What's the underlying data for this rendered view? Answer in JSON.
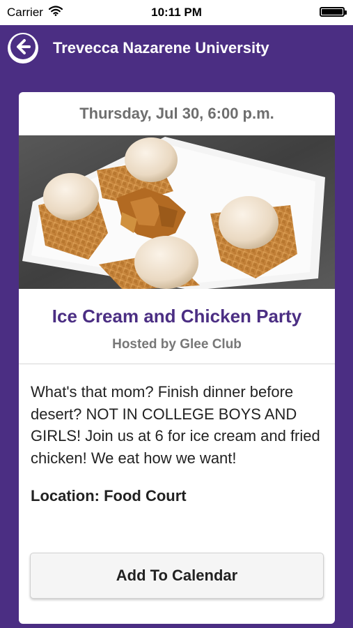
{
  "status_bar": {
    "carrier": "Carrier",
    "time": "10:11 PM"
  },
  "nav": {
    "title": "Trevecca Nazarene University",
    "back_icon": "arrow-left-circle-icon"
  },
  "event": {
    "date": "Thursday, Jul 30, 6:00 p.m.",
    "title": "Ice Cream and Chicken Party",
    "host": "Hosted by Glee Club",
    "description": "What's that mom? Finish dinner before desert? NOT IN COLLEGE BOYS AND GIRLS! Join us at 6 for ice cream and fried chicken! We eat how we want!",
    "location": "Location: Food Court"
  },
  "actions": {
    "add_to_calendar_label": "Add To Calendar"
  },
  "colors": {
    "brand_purple": "#4b2e83",
    "card_background": "#ffffff",
    "date_gray": "#6e6e6e"
  }
}
